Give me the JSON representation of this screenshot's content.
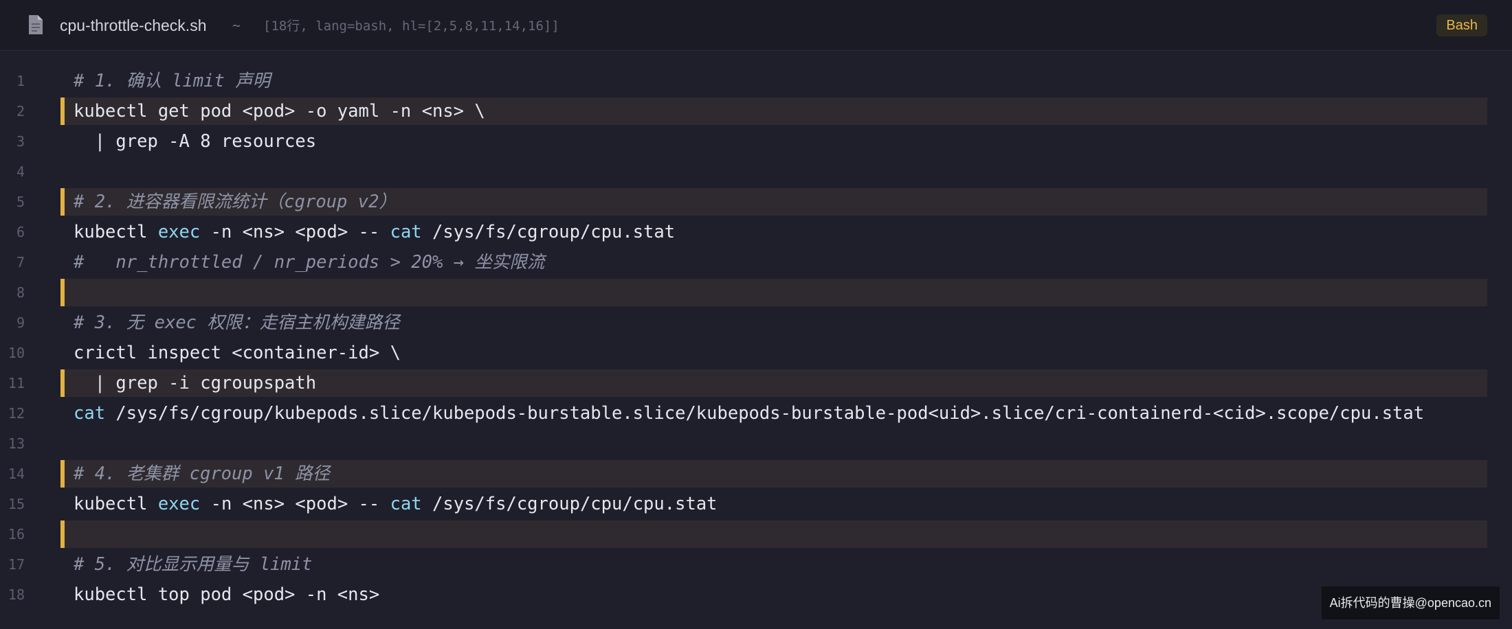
{
  "header": {
    "filename": "cpu-throttle-check.sh",
    "separator": "~",
    "meta": "[18行, lang=bash, hl=[2,5,8,11,14,16]]",
    "language_badge": "Bash",
    "icon": "document-icon"
  },
  "colors": {
    "background": "#1f1f2c",
    "header_background": "#1b1b26",
    "highlight_line": "#2e2a2f",
    "highlight_accent": "#e3b143",
    "text": "#e6e6ee",
    "comment": "#8e93a6",
    "keyword": "#8ed6f0",
    "line_number": "#5b5e70",
    "badge_text": "#e8b84d"
  },
  "code": {
    "highlighted_lines": [
      2,
      5,
      8,
      11,
      14,
      16
    ],
    "lines": [
      {
        "n": "1",
        "hl": false,
        "comment": true,
        "tokens": [
          {
            "t": "# 1. 确认 limit 声明"
          }
        ]
      },
      {
        "n": "2",
        "hl": true,
        "comment": false,
        "tokens": [
          {
            "t": "kubectl get pod <pod> -o yaml -n <ns> \\"
          }
        ]
      },
      {
        "n": "3",
        "hl": false,
        "comment": false,
        "tokens": [
          {
            "t": "  | grep -A 8 resources"
          }
        ]
      },
      {
        "n": "4",
        "hl": false,
        "comment": false,
        "tokens": []
      },
      {
        "n": "5",
        "hl": true,
        "comment": true,
        "tokens": [
          {
            "t": "# 2. 进容器看限流统计（cgroup v2）"
          }
        ]
      },
      {
        "n": "6",
        "hl": false,
        "comment": false,
        "tokens": [
          {
            "t": "kubectl "
          },
          {
            "t": "exec",
            "k": "kw"
          },
          {
            "t": " -n <ns> <pod> -- "
          },
          {
            "t": "cat",
            "k": "kw"
          },
          {
            "t": " /sys/fs/cgroup/cpu.stat"
          }
        ]
      },
      {
        "n": "7",
        "hl": false,
        "comment": true,
        "tokens": [
          {
            "t": "#   nr_throttled / nr_periods > 20% → 坐实限流"
          }
        ]
      },
      {
        "n": "8",
        "hl": true,
        "comment": false,
        "tokens": []
      },
      {
        "n": "9",
        "hl": false,
        "comment": true,
        "tokens": [
          {
            "t": "# 3. 无 exec 权限：走宿主机构建路径"
          }
        ]
      },
      {
        "n": "10",
        "hl": false,
        "comment": false,
        "tokens": [
          {
            "t": "crictl inspect <container-id> \\"
          }
        ]
      },
      {
        "n": "11",
        "hl": true,
        "comment": false,
        "tokens": [
          {
            "t": "  | grep -i cgroupspath"
          }
        ]
      },
      {
        "n": "12",
        "hl": false,
        "comment": false,
        "tokens": [
          {
            "t": "cat",
            "k": "kw"
          },
          {
            "t": " /sys/fs/cgroup/kubepods.slice/kubepods-burstable.slice/kubepods-burstable-pod<uid>.slice/cri-containerd-<cid>.scope/cpu.stat"
          }
        ]
      },
      {
        "n": "13",
        "hl": false,
        "comment": false,
        "tokens": []
      },
      {
        "n": "14",
        "hl": true,
        "comment": true,
        "tokens": [
          {
            "t": "# 4. 老集群 cgroup v1 路径"
          }
        ]
      },
      {
        "n": "15",
        "hl": false,
        "comment": false,
        "tokens": [
          {
            "t": "kubectl "
          },
          {
            "t": "exec",
            "k": "kw"
          },
          {
            "t": " -n <ns> <pod> -- "
          },
          {
            "t": "cat",
            "k": "kw"
          },
          {
            "t": " /sys/fs/cgroup/cpu/cpu.stat"
          }
        ]
      },
      {
        "n": "16",
        "hl": true,
        "comment": false,
        "tokens": []
      },
      {
        "n": "17",
        "hl": false,
        "comment": true,
        "tokens": [
          {
            "t": "# 5. 对比显示用量与 limit"
          }
        ]
      },
      {
        "n": "18",
        "hl": false,
        "comment": false,
        "tokens": [
          {
            "t": "kubectl top pod <pod> -n <ns>"
          }
        ]
      }
    ]
  },
  "watermark": "Ai拆代码的曹操@opencao.cn"
}
